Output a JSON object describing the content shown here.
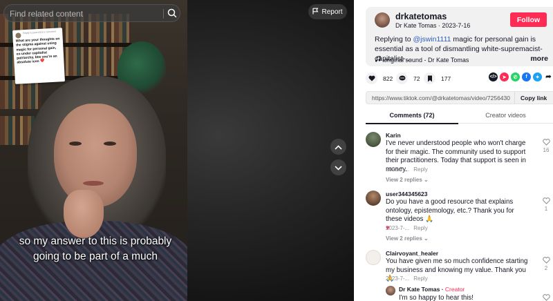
{
  "search": {
    "placeholder": "Find related content"
  },
  "video": {
    "report_label": "Report",
    "caption_line1": "so my answer to this is probably",
    "caption_line2": "going to be part of a much",
    "reply_card": {
      "to": "Reply to jswin1111's comment",
      "text": "What are your thoughts on the stigma against using magic for personal gain, ex-under capitalist patriarchy, btw you're an absolute icon",
      "heart": "❤️"
    }
  },
  "creator": {
    "username": "drkatetomas",
    "display_name": "Dr Kate Tomas",
    "date": "2023-7-16",
    "follow_label": "Follow"
  },
  "description": {
    "prefix": "Replying to",
    "mention": "@jswin1111",
    "text": "magic for personal gain is essential as a tool of dismantling white-supremacist-capitalist-...",
    "more_label": "more"
  },
  "sound": {
    "label": "original sound - Dr Kate Tomas"
  },
  "stats": {
    "likes": "822",
    "comments": "72",
    "saves": "177"
  },
  "link": {
    "url": "https://www.tiktok.com/@drkatetomas/video/7256430...",
    "copy_label": "Copy link"
  },
  "tabs": {
    "comments": "Comments (72)",
    "creator": "Creator videos"
  },
  "comments": [
    {
      "name": "Karin",
      "text": "I've never understood people who won't charge for their magic. The community used to support their practitioners. Today that support is seen in money.",
      "date": "2023-7-...",
      "reply": "Reply",
      "views": "View 2 replies",
      "likes": "16"
    },
    {
      "name": "user344345623",
      "text": "Do you have a good resource that explains ontology, epistemology, etc.? Thank you for these videos 🙏",
      "emoji": "♥",
      "date": "2023-7-...",
      "reply": "Reply",
      "views": "View 2 replies",
      "likes": "1"
    },
    {
      "name": "Clairvoyant_healer",
      "text": "You have given me so much confidence starting my business and knowing my value. Thank you 🙏",
      "date": "2023-7-...",
      "reply": "Reply",
      "likes": "2"
    },
    {
      "name": "Dr Kate Tomas",
      "tag": "Creator",
      "text": "I'm so happy to hear this!"
    }
  ]
}
